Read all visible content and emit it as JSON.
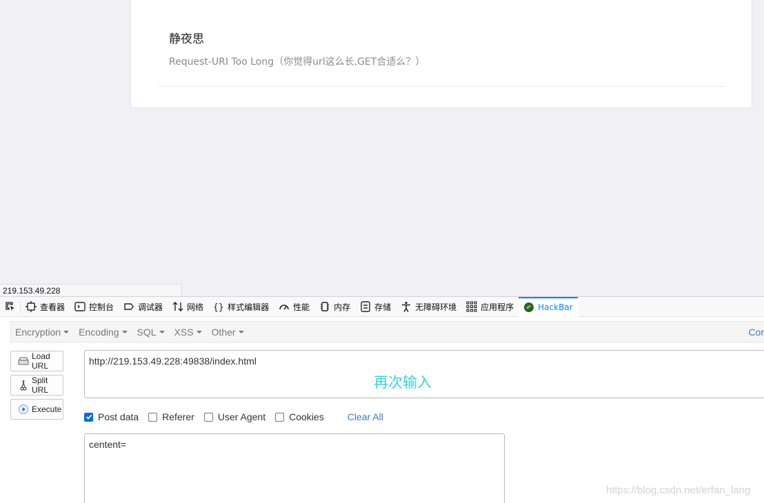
{
  "page": {
    "title": "静夜思",
    "subtitle": "Request-URI Too Long（你觉得url这么长,GET合适么？）"
  },
  "statusbar": {
    "text": "219.153.49.228"
  },
  "devtools": {
    "tabs": [
      {
        "label": "查看器",
        "icon": "inspector-icon"
      },
      {
        "label": "控制台",
        "icon": "console-icon"
      },
      {
        "label": "调试器",
        "icon": "debugger-icon"
      },
      {
        "label": "网络",
        "icon": "network-icon"
      },
      {
        "label": "样式编辑器",
        "icon": "style-editor-icon"
      },
      {
        "label": "性能",
        "icon": "performance-icon"
      },
      {
        "label": "内存",
        "icon": "memory-icon"
      },
      {
        "label": "存储",
        "icon": "storage-icon"
      },
      {
        "label": "无障碍环境",
        "icon": "accessibility-icon"
      },
      {
        "label": "应用程序",
        "icon": "application-icon"
      },
      {
        "label": "HackBar",
        "icon": "hackbar-icon",
        "active": true
      }
    ],
    "accent": "#0a84ff"
  },
  "hackbar": {
    "menu": {
      "encryption": "Encryption",
      "encoding": "Encoding",
      "sql": "SQL",
      "xss": "XSS",
      "other": "Other",
      "right_cut": "Cor"
    },
    "buttons": {
      "load_url": "Load URL",
      "split_url": "Split URL",
      "execute": "Execute"
    },
    "url_value": "http://219.153.49.228:49838/index.html",
    "url_overlay": "再次输入",
    "options": {
      "post_data": "Post data",
      "referer": "Referer",
      "user_agent": "User Agent",
      "cookies": "Cookies",
      "clear_all": "Clear All",
      "post_checked": true
    },
    "post_value": "centent="
  },
  "watermark": "https://blog.csdn.net/erfan_lang"
}
